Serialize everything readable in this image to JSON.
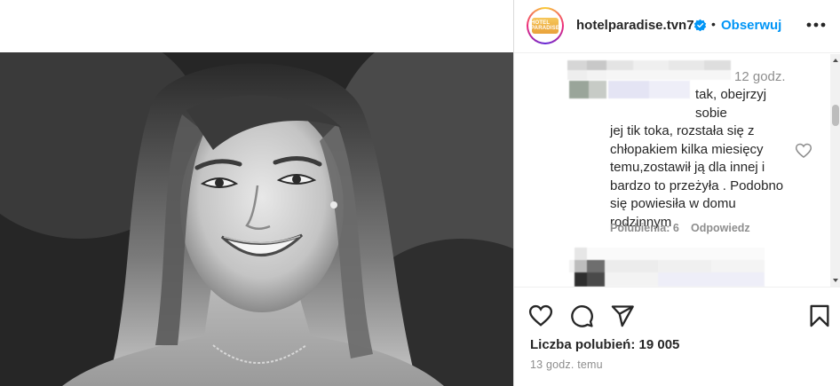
{
  "post": {
    "photo_alt": "black and white portrait of a smiling woman",
    "account": {
      "username": "hotelparadise.tvn7",
      "avatar_text": "HOTEL PARADISE",
      "follow_label": "Obserwuj",
      "separator": "•"
    },
    "comment": {
      "time": "12 godz.",
      "first_line": "tak, obejrzyj sobie",
      "text": "jej tik toka, rozstała się z chłopakiem kilka miesięcy temu,zostawił ją dla innej i bardzo to przeżyła . Podobno się powiesiła w domu rodzinnym",
      "likes_label": "Polubienia: 6",
      "reply_label": "Odpowiedz"
    },
    "likes_label": "Liczba polubień: 19 005",
    "time_label": "13 godz. temu",
    "icons": {
      "like": "heart-icon",
      "comment": "comment-icon",
      "share": "send-icon",
      "save": "bookmark-icon",
      "more": "more-horizontal-icon",
      "verified": "verified-badge-icon"
    },
    "colors": {
      "follow": "#0095f6",
      "verified": "#0095f6",
      "muted": "#8e8e8e",
      "text": "#262626"
    }
  }
}
